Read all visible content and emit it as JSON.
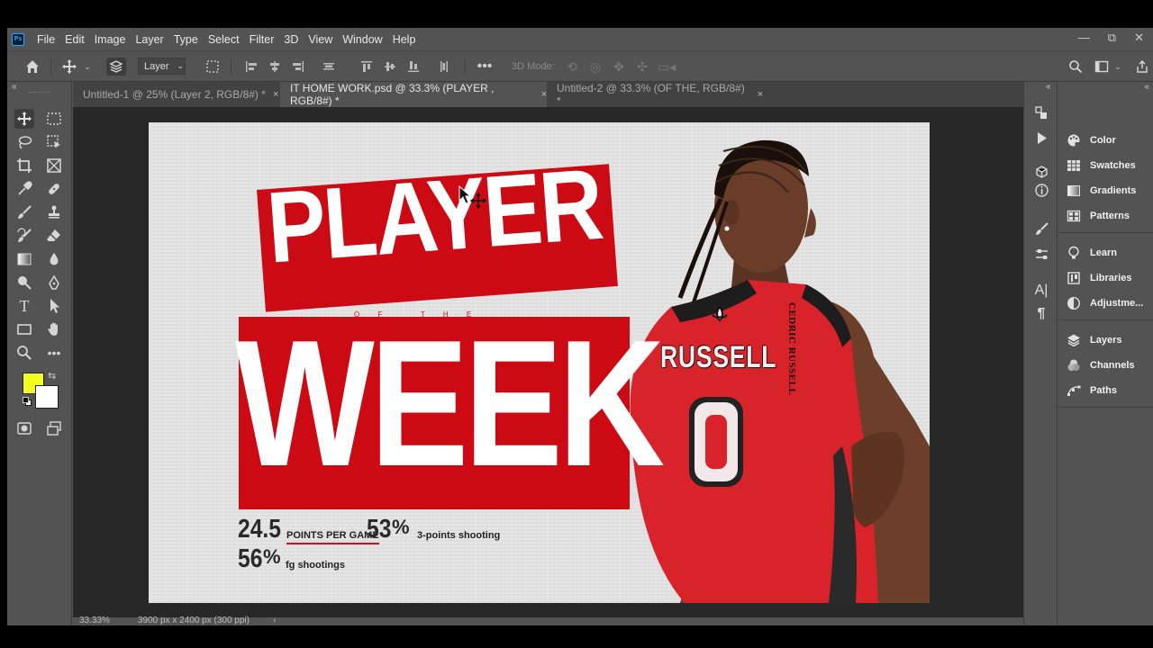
{
  "app": {
    "logo": "Ps"
  },
  "menu": [
    "File",
    "Edit",
    "Image",
    "Layer",
    "Type",
    "Select",
    "Filter",
    "3D",
    "View",
    "Window",
    "Help"
  ],
  "window_controls": {
    "minimize": "—",
    "restore": "⧉",
    "close": "✕"
  },
  "options_bar": {
    "auto_select_target": "Layer",
    "three_d_mode_label": "3D Mode:"
  },
  "tabs": [
    {
      "label": "Untitled-1 @ 25% (Layer 2, RGB/8#) *",
      "close": "×",
      "active": false
    },
    {
      "label": "IT HOME WORK.psd @ 33.3% (PLAYER , RGB/8#) *",
      "close": "×",
      "active": true
    },
    {
      "label": "Untitled-2 @ 33.3% (OF THE, RGB/8#) *",
      "close": "×",
      "active": false
    }
  ],
  "colors": {
    "foreground": "#f0ff1e",
    "background": "#ffffff",
    "poster_red": "#cc0a14",
    "jersey_red": "#d8232a"
  },
  "poster": {
    "headline_top": "PLAYER",
    "of_the": "O F   T H E",
    "headline_bottom": "WEEK",
    "vertical_name": "CEDRIC RUSSELL",
    "jersey_name": "RUSSELL",
    "jersey_number": "0",
    "stats": {
      "points_value": "24.5",
      "points_label": "POINTS PER GAME",
      "three_pct_value": "53",
      "three_pct_unit": "%",
      "three_pct_label": "3-points shooting",
      "fg_value": "56",
      "fg_unit": "%",
      "fg_label": "fg shootings"
    }
  },
  "status": {
    "zoom": "33.33%",
    "doc_info": "3900 px x 2400 px (300 ppi)",
    "arrow": "›"
  },
  "panels": [
    {
      "label": "Color",
      "icon": "color-palette-icon"
    },
    {
      "label": "Swatches",
      "icon": "swatches-grid-icon"
    },
    {
      "label": "Gradients",
      "icon": "gradient-icon"
    },
    {
      "label": "Patterns",
      "icon": "patterns-grid-icon"
    },
    {
      "label": "Learn",
      "icon": "lightbulb-icon"
    },
    {
      "label": "Libraries",
      "icon": "libraries-icon"
    },
    {
      "label": "Adjustme...",
      "icon": "adjustments-icon"
    },
    {
      "label": "Layers",
      "icon": "layers-icon"
    },
    {
      "label": "Channels",
      "icon": "channels-icon"
    },
    {
      "label": "Paths",
      "icon": "paths-icon"
    }
  ],
  "collapse": {
    "left": "«",
    "right": "«"
  }
}
